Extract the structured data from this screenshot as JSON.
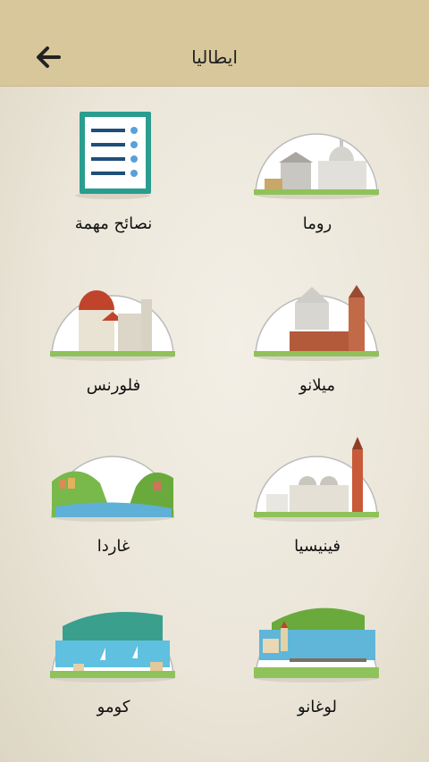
{
  "header": {
    "title": "ايطاليا",
    "back_icon": "arrow-left-icon"
  },
  "tiles": [
    {
      "label": "روما",
      "icon": "rome-landmarks-icon"
    },
    {
      "label": "نصائح مهمة",
      "icon": "checklist-icon"
    },
    {
      "label": "ميلانو",
      "icon": "milan-castle-icon"
    },
    {
      "label": "فلورنس",
      "icon": "florence-duomo-icon"
    },
    {
      "label": "فينيسيا",
      "icon": "venice-basilica-icon"
    },
    {
      "label": "غاردا",
      "icon": "garda-lake-icon"
    },
    {
      "label": "لوغانو",
      "icon": "lugano-lake-icon"
    },
    {
      "label": "كومو",
      "icon": "como-lake-icon"
    }
  ],
  "colors": {
    "header": "#d8c79b",
    "accent": "#2a9d8f",
    "text": "#111111"
  }
}
